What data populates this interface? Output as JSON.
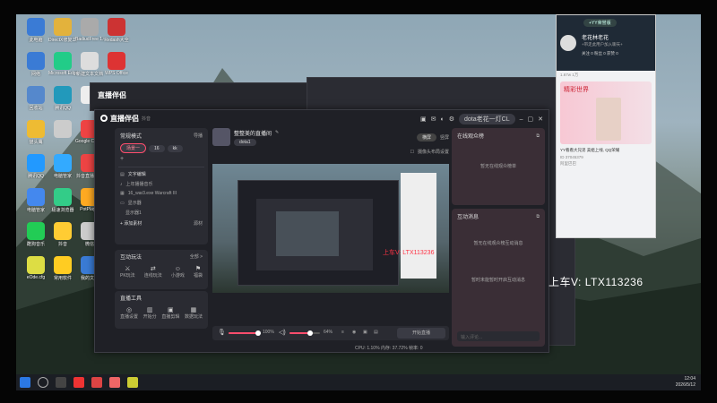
{
  "desktop": {
    "icons": [
      {
        "label": "此电脑"
      },
      {
        "label": "DirectX修复工具"
      },
      {
        "label": "BadiudFree 1.0"
      },
      {
        "label": "Redash大全"
      },
      {
        "label": "网络"
      },
      {
        "label": "Microsoft Edge"
      },
      {
        "label": "新建文本文档"
      },
      {
        "label": "WPS Office"
      },
      {
        "label": "回收站"
      },
      {
        "label": "腾讯QQ"
      },
      {
        "label": ""
      },
      {
        "label": "Steam"
      },
      {
        "label": "猫头鹰"
      },
      {
        "label": ""
      },
      {
        "label": "Google Chrome"
      },
      {
        "label": "爱奇艺"
      },
      {
        "label": "腾讯QQ"
      },
      {
        "label": "电脑管家"
      },
      {
        "label": "抖音直播伴侣"
      },
      {
        "label": "PlotPlayer 64 bit"
      },
      {
        "label": "电脑管家"
      },
      {
        "label": "极速浏览器"
      },
      {
        "label": "PotPlayer"
      },
      {
        "label": "电脑管家"
      },
      {
        "label": "酷狗音乐"
      },
      {
        "label": "抖音"
      },
      {
        "label": "微信"
      },
      {
        "label": "网吧下载"
      },
      {
        "label": "eOde.cfg"
      },
      {
        "label": "常用软件"
      },
      {
        "label": "我的文档"
      },
      {
        "label": "978d14e9..."
      }
    ]
  },
  "app": {
    "title": "直播伴侣",
    "version": "8.5.6.4",
    "second_title": "直播伴侣",
    "second_tag": "抖音",
    "user_name": "dota老花一灯CL",
    "mode_label": "常规模式",
    "guide_label": "导播",
    "scene_tabs": [
      "场景一",
      "16",
      "kk"
    ],
    "add_label": "+",
    "source_header": "文字编辑",
    "sources": [
      {
        "label": "上年播播音乐"
      },
      {
        "label": "16_war3.exe Warcraft III"
      },
      {
        "label": "显示器"
      },
      {
        "label": "显示器1"
      }
    ],
    "add_material": "+ 添加素材",
    "paste_label": "源材",
    "interactive_header": "互动玩法",
    "interactive_more": "全部 >",
    "interactive_items": [
      "PK",
      "连线",
      "礼物",
      "PK",
      "福袋"
    ],
    "interactive_labels": [
      "PK玩法",
      "连线玩法",
      "小游戏",
      "PK模式",
      "福袋"
    ],
    "tools_header": "直播工具",
    "tools": [
      "直播设置",
      "开始分",
      "直播剪辑",
      "数据玩法"
    ],
    "stream_title": "整整美的直播间",
    "stream_edit": "修改",
    "stream_sub": "dota1",
    "landscape_label": "横屏",
    "portrait_label": "竖屏",
    "camera_toggle": "摄像头布局设置",
    "mic_volume": "100%",
    "speaker_volume": "64%",
    "start_label": "开始直播",
    "status_bar": "CPU: 1.10%   内存: 37.72%   帧率: 0",
    "audience_header": "在线观众榜",
    "audience_empty": "暂无在线观众榜单",
    "interact_msg_header": "互动消息",
    "interact_msg_empty_1": "暂无在线观众榜互动消息",
    "interact_msg_empty_2": "暂时未能暂时开启互动消息",
    "chat_input_placeholder": "输入评论..."
  },
  "preview_overlay_text": "上车V: LTX113236",
  "watermark_text": "上车V:  LTX113236",
  "chat_window": {
    "top_badge": "+YY荣誉版",
    "name": "老花林老花",
    "subtitle": "+带走此用户加入聊天+",
    "stats": "关注 0  粉丝 0  获赞 0",
    "section_title": "精彩世界",
    "count": "1.67w  1万",
    "item_title": "YY看看大兄弟 美姐上线, QQ荣耀",
    "item_sub": "ID 37045379",
    "item_more": "阿里巴巴"
  },
  "taskbar": {
    "time": "12:04",
    "date": "2026/5/12"
  },
  "colors": {
    "accent": "#ff4d6d",
    "window_bg": "#1f2026",
    "panel_bg": "#2a2b32"
  }
}
